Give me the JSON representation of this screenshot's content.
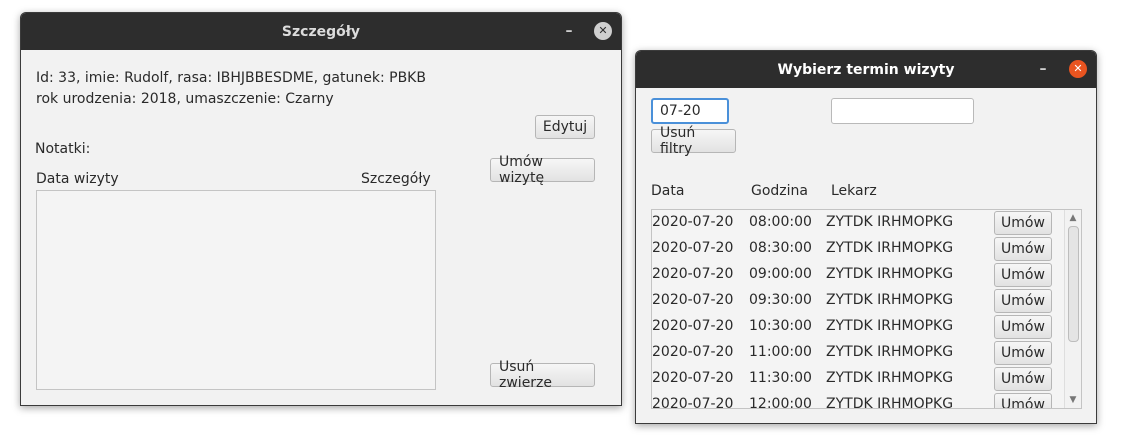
{
  "details_window": {
    "title": "Szczegóły",
    "minimize_glyph": "–",
    "close_glyph": "✕",
    "info_line1": "Id: 33, imie: Rudolf, rasa: IBHJBBESDME, gatunek: PBKB",
    "info_line2": "rok urodzenia: 2018, umaszczenie: Czarny",
    "edit_button": "Edytuj",
    "notes_label": "Notatki:",
    "book_visit_button": "Umów wizytę",
    "visits_header_date": "Data wizyty",
    "visits_header_details": "Szczegóły",
    "delete_animal_button": "Usuń zwierze"
  },
  "schedule_window": {
    "title": "Wybierz termin wizyty",
    "minimize_glyph": "–",
    "close_glyph": "✕",
    "date_filter_value": "07-20",
    "doctor_filter_value": "",
    "clear_filters_button": "Usuń filtry",
    "header_date": "Data",
    "header_time": "Godzina",
    "header_doctor": "Lekarz",
    "slots": [
      {
        "date": "2020-07-20",
        "time": "08:00:00",
        "doctor": "ZYTDK IRHMOPKG",
        "action": "Umów"
      },
      {
        "date": "2020-07-20",
        "time": "08:30:00",
        "doctor": "ZYTDK IRHMOPKG",
        "action": "Umów"
      },
      {
        "date": "2020-07-20",
        "time": "09:00:00",
        "doctor": "ZYTDK IRHMOPKG",
        "action": "Umów"
      },
      {
        "date": "2020-07-20",
        "time": "09:30:00",
        "doctor": "ZYTDK IRHMOPKG",
        "action": "Umów"
      },
      {
        "date": "2020-07-20",
        "time": "10:30:00",
        "doctor": "ZYTDK IRHMOPKG",
        "action": "Umów"
      },
      {
        "date": "2020-07-20",
        "time": "11:00:00",
        "doctor": "ZYTDK IRHMOPKG",
        "action": "Umów"
      },
      {
        "date": "2020-07-20",
        "time": "11:30:00",
        "doctor": "ZYTDK IRHMOPKG",
        "action": "Umów"
      },
      {
        "date": "2020-07-20",
        "time": "12:00:00",
        "doctor": "ZYTDK IRHMOPKG",
        "action": "Umów"
      }
    ]
  },
  "colors": {
    "titlebar": "#2d2d2d",
    "window_bg": "#f2f2f2",
    "close_active": "#e95420",
    "focus_ring": "#4a90d9"
  }
}
